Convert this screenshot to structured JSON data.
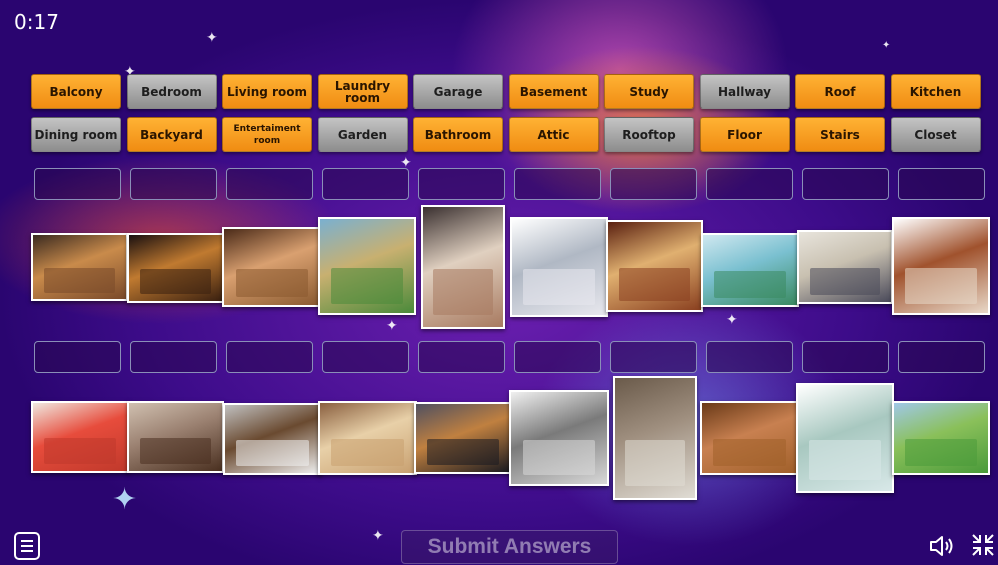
{
  "timer": "0:17",
  "labels": [
    {
      "text": "Balcony",
      "style": "orange"
    },
    {
      "text": "Bedroom",
      "style": "gray"
    },
    {
      "text": "Living room",
      "style": "orange"
    },
    {
      "text": "Laundry room",
      "style": "orange"
    },
    {
      "text": "Garage",
      "style": "gray"
    },
    {
      "text": "Basement",
      "style": "orange"
    },
    {
      "text": "Study",
      "style": "orange"
    },
    {
      "text": "Hallway",
      "style": "gray"
    },
    {
      "text": "Roof",
      "style": "orange"
    },
    {
      "text": "Kitchen",
      "style": "orange"
    },
    {
      "text": "Dining room",
      "style": "gray"
    },
    {
      "text": "Backyard",
      "style": "orange"
    },
    {
      "text": "Entertaiment room",
      "style": "orange"
    },
    {
      "text": "Garden",
      "style": "gray"
    },
    {
      "text": "Bathroom",
      "style": "orange"
    },
    {
      "text": "Attic",
      "style": "orange"
    },
    {
      "text": "Rooftop",
      "style": "gray"
    },
    {
      "text": "Floor",
      "style": "orange"
    },
    {
      "text": "Stairs",
      "style": "orange"
    },
    {
      "text": "Closet",
      "style": "gray"
    }
  ],
  "row1_photos": [
    "study",
    "entertainment-room",
    "closet",
    "backyard",
    "balcony",
    "laundry-room",
    "dining-room",
    "rooftop",
    "bedroom",
    "stairs"
  ],
  "row2_photos": [
    "roof",
    "basement",
    "kitchen",
    "attic",
    "garage",
    "living-room",
    "hallway",
    "floor",
    "bathroom",
    "garden"
  ],
  "submit_label": "Submit Answers",
  "icons": {
    "menu": "menu-icon",
    "speaker": "speaker-icon",
    "fullscreen": "collapse-fullscreen-icon"
  },
  "colors": {
    "label_orange": "#f5a11f",
    "label_gray": "#a9a9a9",
    "background": "#4a1296"
  }
}
